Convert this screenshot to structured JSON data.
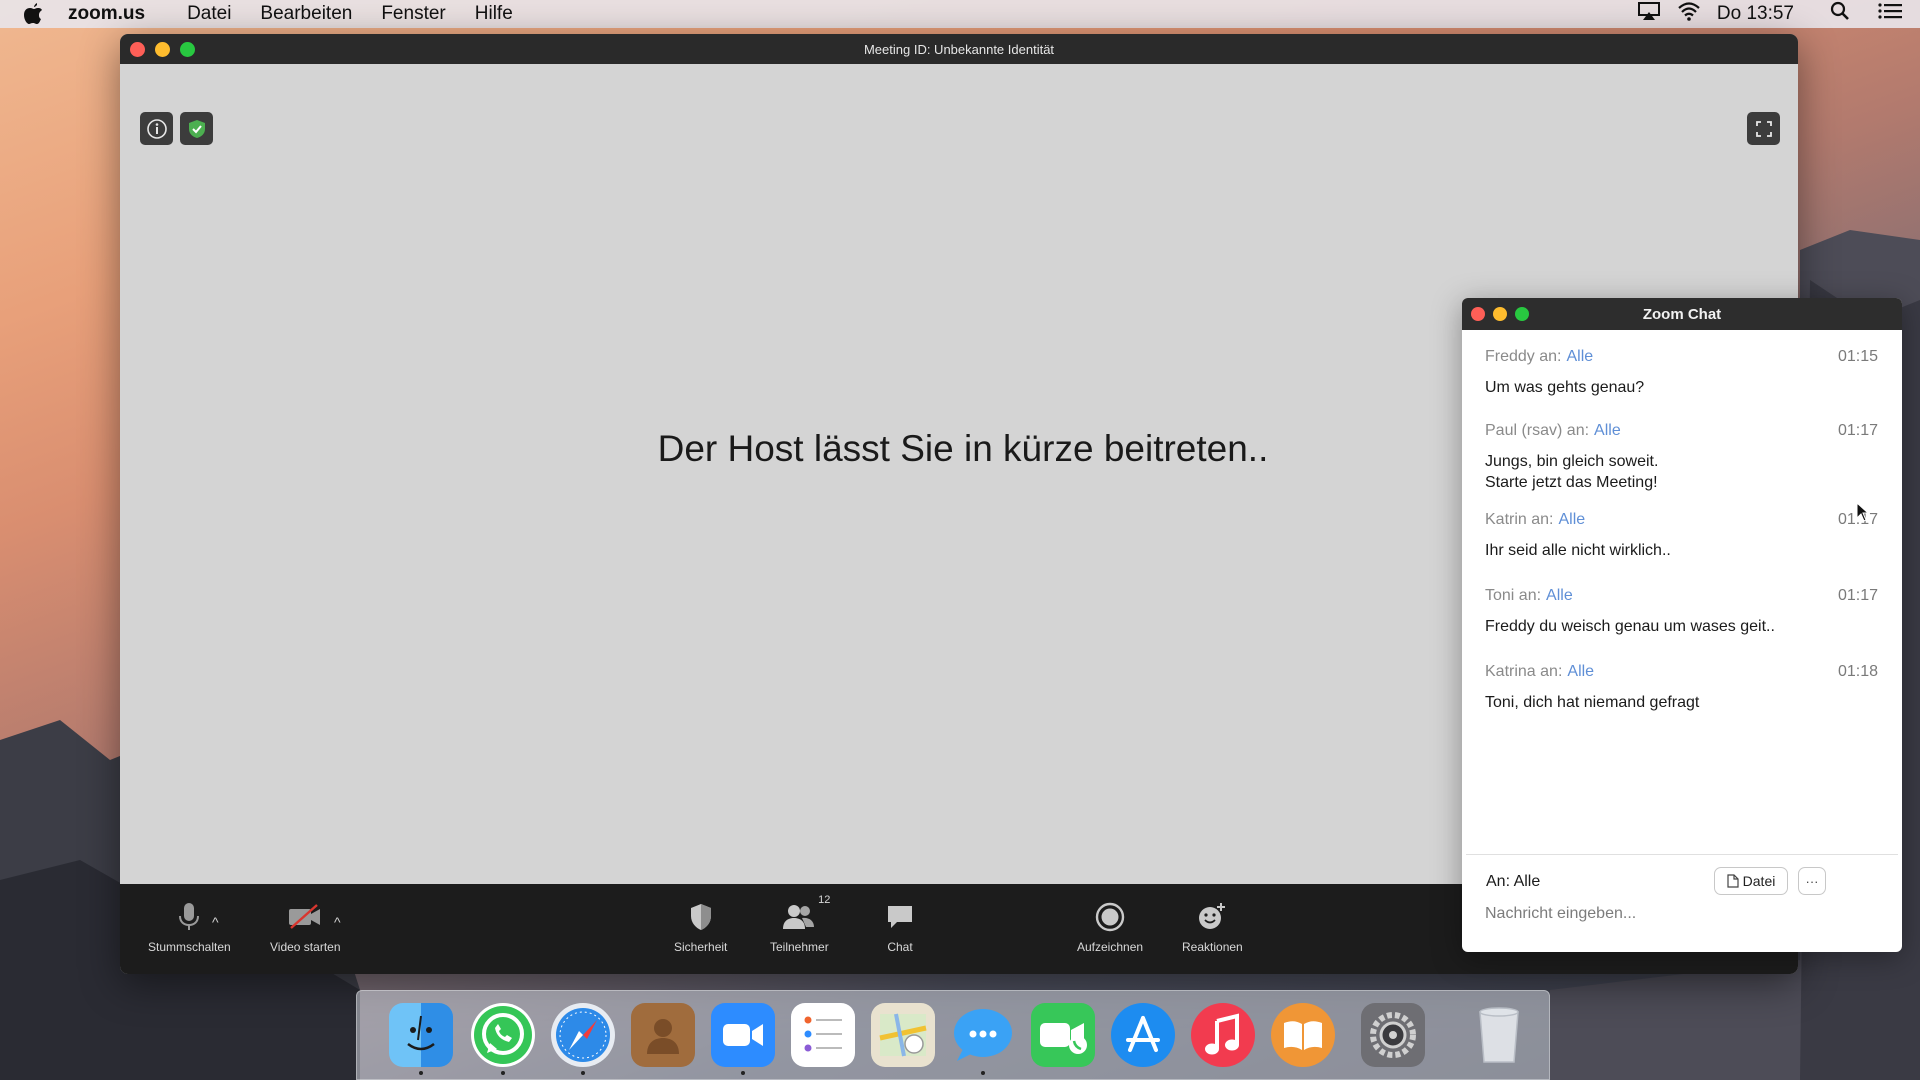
{
  "menubar": {
    "app_name": "zoom.us",
    "menus": [
      "Datei",
      "Bearbeiten",
      "Fenster",
      "Hilfe"
    ],
    "clock": "Do 13:57"
  },
  "zoom_window": {
    "title": "Meeting ID: Unbekannte Identität",
    "wait_message": "Der Host lässt Sie in kürze beitreten..",
    "toolbar": {
      "mute": "Stummschalten",
      "video": "Video starten",
      "security": "Sicherheit",
      "participants": "Teilnehmer",
      "participants_count": "12",
      "chat": "Chat",
      "record": "Aufzeichnen",
      "reactions": "Reaktionen"
    }
  },
  "chat": {
    "title": "Zoom Chat",
    "messages": [
      {
        "sender": "Freddy an:",
        "to": "Alle",
        "time": "01:15",
        "text": "Um was gehts genau?"
      },
      {
        "sender": "Paul (rsav) an:",
        "to": "Alle",
        "time": "01:17",
        "text": "Jungs, bin gleich soweit.\nStarte jetzt das Meeting!"
      },
      {
        "sender": "Katrin an:",
        "to": "Alle",
        "time": "01:17",
        "text": "Ihr seid alle nicht wirklich.."
      },
      {
        "sender": "Toni an:",
        "to": "Alle",
        "time": "01:17",
        "text": "Freddy du weisch genau um wases geit.."
      },
      {
        "sender": "Katrina an:",
        "to": "Alle",
        "time": "01:18",
        "text": "Toni, dich hat niemand gefragt"
      }
    ],
    "recipient": "An: Alle",
    "file_button": "Datei",
    "more_button": "···",
    "input_placeholder": "Nachricht eingeben...",
    "input_value": ""
  },
  "dock": {
    "apps": [
      "finder-icon",
      "whatsapp-icon",
      "safari-icon",
      "contacts-icon",
      "zoom-icon",
      "reminders-icon",
      "maps-icon",
      "messages-icon",
      "facetime-icon",
      "app-store-icon",
      "itunes-icon",
      "ibooks-icon",
      "system-preferences-icon",
      "trash-icon"
    ]
  },
  "colors": {
    "link_blue": "#5f8fd6",
    "toolbar_bg": "#1c1c1c",
    "meeting_bg": "#d4d4d4",
    "security_green": "#4caf50"
  }
}
